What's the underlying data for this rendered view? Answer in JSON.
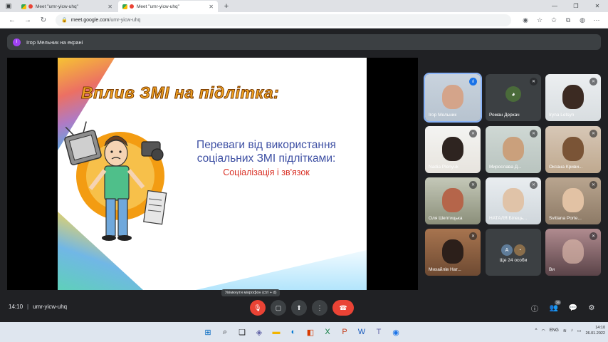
{
  "browser": {
    "tabs": [
      {
        "title": "Meet \"umr-yicw-uhq\"",
        "active": false
      },
      {
        "title": "Meet \"umr-yicw-uhq\"",
        "active": true
      }
    ],
    "url_host": "meet.google.com",
    "url_path": "/umr-yicw-uhq"
  },
  "banner": {
    "avatar_letter": "І",
    "text": "Ігор Мельник на екрані"
  },
  "slide": {
    "title": "Вплив ЗМІ на підлітка:",
    "heading": "Переваги від використання соціальних ЗМІ підлітками:",
    "subheading": "Соціалізація і зв'язок"
  },
  "participants": [
    {
      "name": "Ігор Мельник",
      "speaking": true
    },
    {
      "name": "Роман Деркач",
      "speaking": false
    },
    {
      "name": "Iryna Letsyn",
      "speaking": false
    },
    {
      "name": "Nadia Plenyuk",
      "speaking": false
    },
    {
      "name": "Мирослава Д...",
      "speaking": false
    },
    {
      "name": "Оксана Криви...",
      "speaking": false
    },
    {
      "name": "Оля Шептицька",
      "speaking": false
    },
    {
      "name": "НАТАЛЯ Білець...",
      "speaking": false
    },
    {
      "name": "Svitlana Porte...",
      "speaking": false
    },
    {
      "name": "Михайлів Нат...",
      "speaking": false
    },
    {
      "name": "Ще 24 особи",
      "speaking": false
    },
    {
      "name": "Ви",
      "speaking": false
    }
  ],
  "others_avatar_letter": "A",
  "toolbar": {
    "time": "14:10",
    "meeting_code": "umr-yicw-uhq",
    "mic_tooltip": "Увімкнути мікрофон (ctrl + d)",
    "people_count": "36"
  },
  "taskbar": {
    "lang": "ENG",
    "time": "14:10",
    "date": "26.01.2022"
  },
  "colors": {
    "meet_bg": "#202124",
    "tile_bg": "#3c4043",
    "hangup_red": "#ea4335",
    "speaking_blue": "#1a73e8",
    "slide_title_orange": "#f5a623",
    "slide_heading_blue": "#3d4fa3",
    "slide_sub_red": "#d93025"
  }
}
